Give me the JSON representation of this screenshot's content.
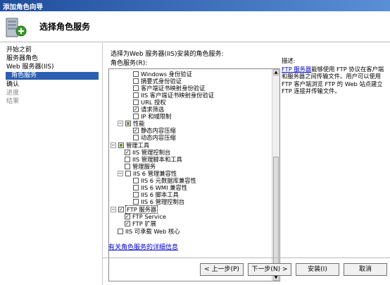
{
  "window": {
    "title": "添加角色向导"
  },
  "header": {
    "title": "选择角色服务"
  },
  "nav": {
    "items": [
      {
        "label": "开始之前",
        "state": "normal"
      },
      {
        "label": "服务器角色",
        "state": "normal"
      },
      {
        "label": "Web 服务器(IIS)",
        "state": "normal"
      },
      {
        "label": "角色服务",
        "state": "selected"
      },
      {
        "label": "确认",
        "state": "normal"
      },
      {
        "label": "进度",
        "state": "disabled"
      },
      {
        "label": "结果",
        "state": "disabled"
      }
    ]
  },
  "main": {
    "prompt": "选择为Web 服务器(IIS)安装的角色服务:",
    "list_label": "角色服务(R):",
    "tree": [
      {
        "label": "Windows 身份验证",
        "checked": false
      },
      {
        "label": "摘要式身份验证",
        "checked": false
      },
      {
        "label": "客户端证书映射身份验证",
        "checked": false
      },
      {
        "label": "IIS 客户端证书映射身份验证",
        "checked": false
      },
      {
        "label": "URL 授权",
        "checked": false
      },
      {
        "label": "请求筛选",
        "checked": true
      },
      {
        "label": "IP 和域限制",
        "checked": false
      },
      {
        "label": "性能",
        "checked": "partial",
        "expander": "−"
      },
      {
        "label": "静态内容压缩",
        "checked": true
      },
      {
        "label": "动态内容压缩",
        "checked": false
      },
      {
        "label": "管理工具",
        "checked": "partial",
        "expander": "−"
      },
      {
        "label": "IIS 管理控制台",
        "checked": true
      },
      {
        "label": "IIS 管理脚本和工具",
        "checked": false
      },
      {
        "label": "管理服务",
        "checked": false
      },
      {
        "label": "IIS 6 管理兼容性",
        "checked": false,
        "expander": "−"
      },
      {
        "label": "IIS 6 元数据库兼容性",
        "checked": false
      },
      {
        "label": "IIS 6 WMI 兼容性",
        "checked": false
      },
      {
        "label": "IIS 6 脚本工具",
        "checked": false
      },
      {
        "label": "IIS 6 管理控制台",
        "checked": false
      },
      {
        "label": "FTP 服务器",
        "checked": true,
        "expander": "−",
        "highlight": true
      },
      {
        "label": "FTP Service",
        "checked": true
      },
      {
        "label": "FTP 扩展",
        "checked": true
      },
      {
        "label": "IIS 可承载 Web 核心",
        "checked": false
      }
    ],
    "more_link": "有关角色服务的详细信息",
    "description": {
      "title": "描述:",
      "link": "FTP 服务器",
      "text": "能够使用 FTP 协议在客户端和服务器之间传输文件。用户可以使用 FTP 客户端浏览 FTP 的 Web 站点建立 FTP 连接并传输文件。"
    }
  },
  "buttons": {
    "prev": "< 上一步(P)",
    "next": "下一步(N) >",
    "install": "安装(I)",
    "cancel": "取消"
  }
}
